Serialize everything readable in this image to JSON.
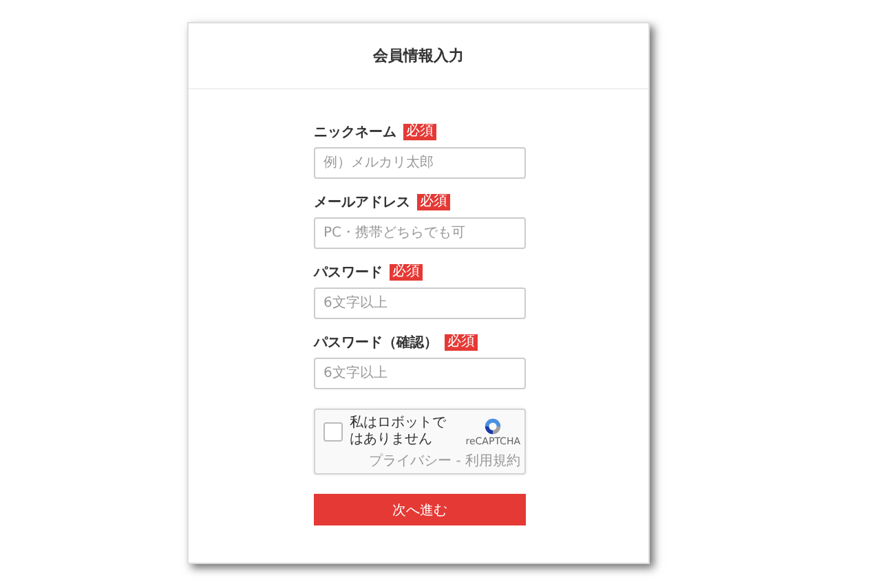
{
  "title": "会員情報入力",
  "fields": [
    {
      "label": "ニックネーム",
      "badge": "必須",
      "placeholder": "例）メルカリ太郎"
    },
    {
      "label": "メールアドレス",
      "badge": "必須",
      "placeholder": "PC・携帯どちらでも可"
    },
    {
      "label": "パスワード",
      "badge": "必須",
      "placeholder": "6文字以上"
    },
    {
      "label": "パスワード（確認）",
      "badge": "必須",
      "placeholder": "6文字以上"
    }
  ],
  "captcha": {
    "label": "私はロボットではありません",
    "checked": false,
    "brand": "reCAPTCHA",
    "links": "プライバシー - 利用規約"
  },
  "submit": "次へ進む"
}
